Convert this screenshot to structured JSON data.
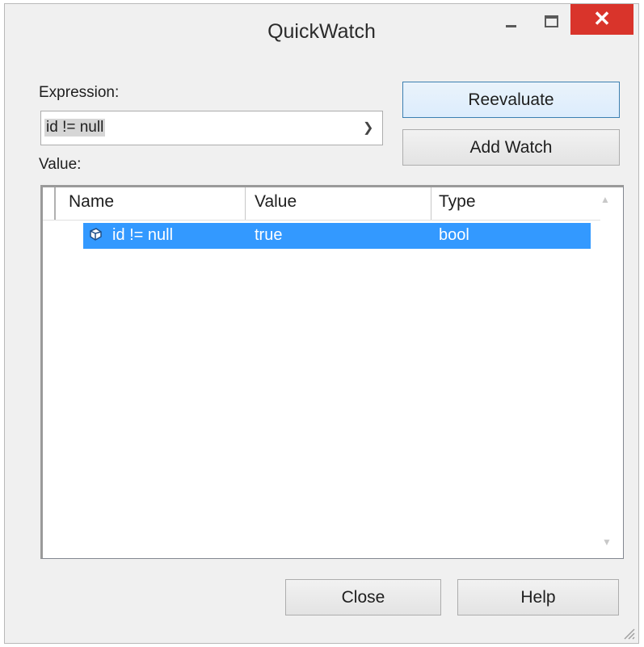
{
  "window": {
    "title": "QuickWatch",
    "controls": {
      "minimize_icon": "minimize-icon",
      "maximize_icon": "maximize-icon",
      "close_glyph": "✕"
    }
  },
  "expression": {
    "label": "Expression:",
    "value": "id != null",
    "dropdown_icon": "chevron-down-icon"
  },
  "buttons": {
    "reevaluate": "Reevaluate",
    "add_watch": "Add Watch",
    "close": "Close",
    "help": "Help"
  },
  "value_section": {
    "label": "Value:",
    "columns": [
      "Name",
      "Value",
      "Type"
    ],
    "rows": [
      {
        "name": "id != null",
        "value": "true",
        "type": "bool",
        "icon": "field-icon",
        "selected": true
      }
    ]
  },
  "colors": {
    "selection": "#3399ff",
    "close_button": "#d9342b",
    "dialog_bg": "#f0f0f0"
  }
}
